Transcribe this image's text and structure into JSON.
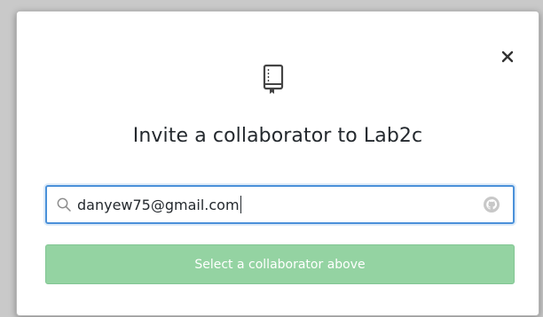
{
  "modal": {
    "title_prefix": "Invite a collaborator to ",
    "repo_name": "Lab2c",
    "close_label": "×"
  },
  "search": {
    "value": "danyew75@gmail.com",
    "placeholder": ""
  },
  "submit": {
    "label": "Select a collaborator above",
    "disabled": true
  },
  "colors": {
    "accent_border": "#4a90d9",
    "button_bg": "#94d3a2",
    "title_text": "#24292e"
  },
  "icons": {
    "repo": "repo-book-icon",
    "search": "search-icon",
    "avatar": "github-octocat-icon",
    "close": "close-icon"
  }
}
